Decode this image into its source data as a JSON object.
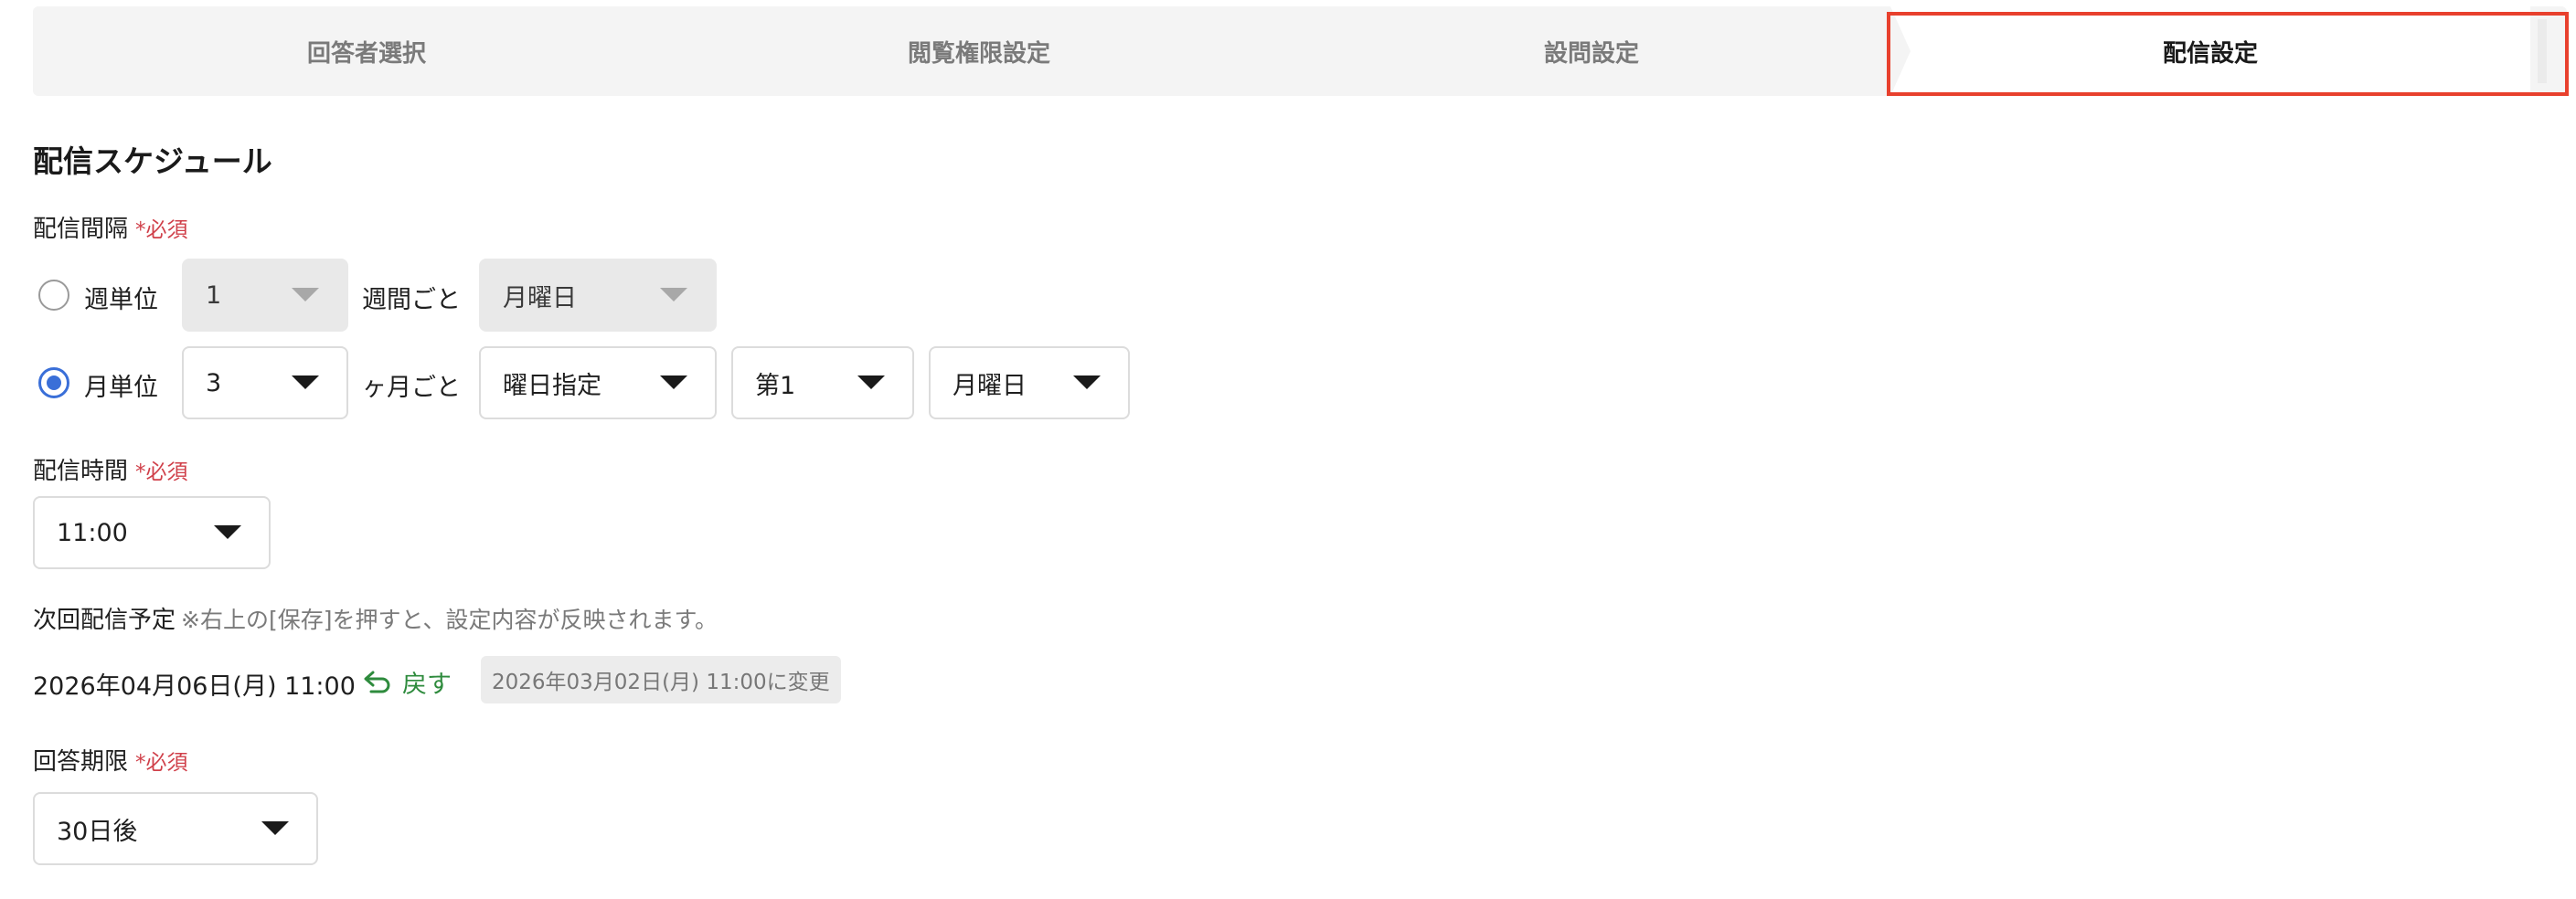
{
  "stepper": {
    "steps": [
      {
        "label": "回答者選択"
      },
      {
        "label": "閲覧権限設定"
      },
      {
        "label": "設問設定"
      },
      {
        "label": "配信設定"
      }
    ]
  },
  "schedule": {
    "title": "配信スケジュール",
    "interval": {
      "label": "配信間隔",
      "required": "*必須",
      "weekly": {
        "label": "週単位",
        "selected": false,
        "count_value": "1",
        "unit_text": "週間ごと",
        "weekday_value": "月曜日"
      },
      "monthly": {
        "label": "月単位",
        "selected": true,
        "count_value": "3",
        "unit_text": "ヶ月ごと",
        "mode_value": "曜日指定",
        "ordinal_value": "第1",
        "weekday_value": "月曜日"
      }
    },
    "time": {
      "label": "配信時間",
      "required": "*必須",
      "value": "11:00"
    },
    "next": {
      "label": "次回配信予定",
      "note": "※右上の[保存]を押すと、設定内容が反映されます。",
      "value": "2026年04月06日(月) 11:00",
      "revert_label": "戻す",
      "change_tag": "2026年03月02日(月) 11:00に変更"
    },
    "deadline": {
      "label": "回答期限",
      "required": "*必須",
      "value": "30日後"
    }
  },
  "colors": {
    "accent": "#3a6fd8",
    "required": "#d0404a",
    "revert": "#2e8b3d",
    "active_outline": "#e8402d"
  }
}
